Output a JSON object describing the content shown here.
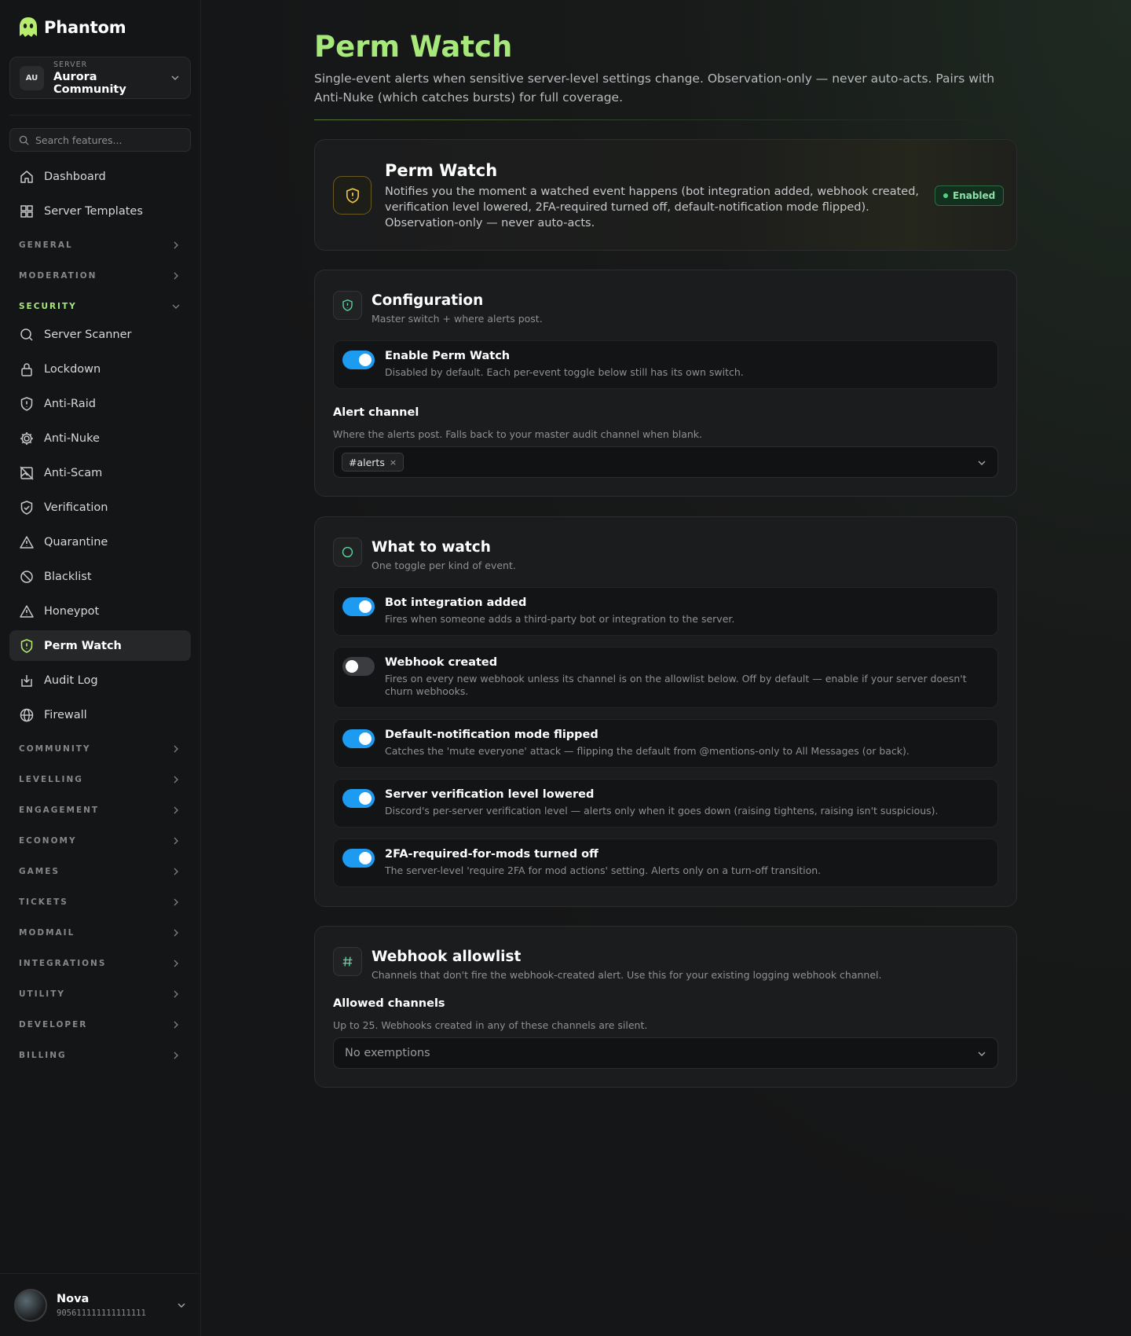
{
  "app": {
    "name": "Phantom"
  },
  "server": {
    "label": "SERVER",
    "initials": "AU",
    "name": "Aurora Community"
  },
  "search": {
    "placeholder": "Search features..."
  },
  "nav_top": [
    "Dashboard",
    "Server Templates"
  ],
  "sections": {
    "general": "GENERAL",
    "moderation": "MODERATION",
    "security": "SECURITY",
    "community": "COMMUNITY",
    "levelling": "LEVELLING",
    "engagement": "ENGAGEMENT",
    "economy": "ECONOMY",
    "games": "GAMES",
    "tickets": "TICKETS",
    "modmail": "MODMAIL",
    "integrations": "INTEGRATIONS",
    "utility": "UTILITY",
    "developer": "DEVELOPER",
    "billing": "BILLING"
  },
  "security_items": [
    "Server Scanner",
    "Lockdown",
    "Anti-Raid",
    "Anti-Nuke",
    "Anti-Scam",
    "Verification",
    "Quarantine",
    "Blacklist",
    "Honeypot",
    "Perm Watch",
    "Audit Log",
    "Firewall"
  ],
  "active_item": "Perm Watch",
  "user": {
    "name": "Nova",
    "id": "905611111111111111"
  },
  "page": {
    "title": "Perm Watch",
    "description": "Single-event alerts when sensitive server-level settings change. Observation-only — never auto-acts. Pairs with Anti-Nuke (which catches bursts) for full coverage."
  },
  "hero": {
    "title": "Perm Watch",
    "description": "Notifies you the moment a watched event happens (bot integration added, webhook created, verification level lowered, 2FA-required turned off, default-notification mode flipped). Observation-only — never auto-acts.",
    "status": "Enabled"
  },
  "configuration": {
    "title": "Configuration",
    "subtitle": "Master switch + where alerts post.",
    "enable": {
      "title": "Enable Perm Watch",
      "desc": "Disabled by default. Each per-event toggle below still has its own switch.",
      "on": true
    },
    "alert_channel": {
      "label": "Alert channel",
      "help": "Where the alerts post. Falls back to your master audit channel when blank.",
      "value": "#alerts",
      "remove": "×"
    }
  },
  "watch": {
    "title": "What to watch",
    "subtitle": "One toggle per kind of event.",
    "items": [
      {
        "title": "Bot integration added",
        "desc": "Fires when someone adds a third-party bot or integration to the server.",
        "on": true
      },
      {
        "title": "Webhook created",
        "desc": "Fires on every new webhook unless its channel is on the allowlist below. Off by default — enable if your server doesn't churn webhooks.",
        "on": false
      },
      {
        "title": "Default-notification mode flipped",
        "desc": "Catches the 'mute everyone' attack — flipping the default from @mentions-only to All Messages (or back).",
        "on": true
      },
      {
        "title": "Server verification level lowered",
        "desc": "Discord's per-server verification level — alerts only when it goes down (raising tightens, raising isn't suspicious).",
        "on": true
      },
      {
        "title": "2FA-required-for-mods turned off",
        "desc": "The server-level 'require 2FA for mod actions' setting. Alerts only on a turn-off transition.",
        "on": true
      }
    ]
  },
  "allowlist": {
    "title": "Webhook allowlist",
    "subtitle": "Channels that don't fire the webhook-created alert. Use this for your existing logging webhook channel.",
    "label": "Allowed channels",
    "help": "Up to 25. Webhooks created in any of these channels are silent.",
    "placeholder": "No exemptions"
  },
  "colors": {
    "accent": "#a6e87a",
    "toggle_on": "#1d9bf0",
    "enabled_green": "#4fd27f",
    "background": "#151617"
  }
}
